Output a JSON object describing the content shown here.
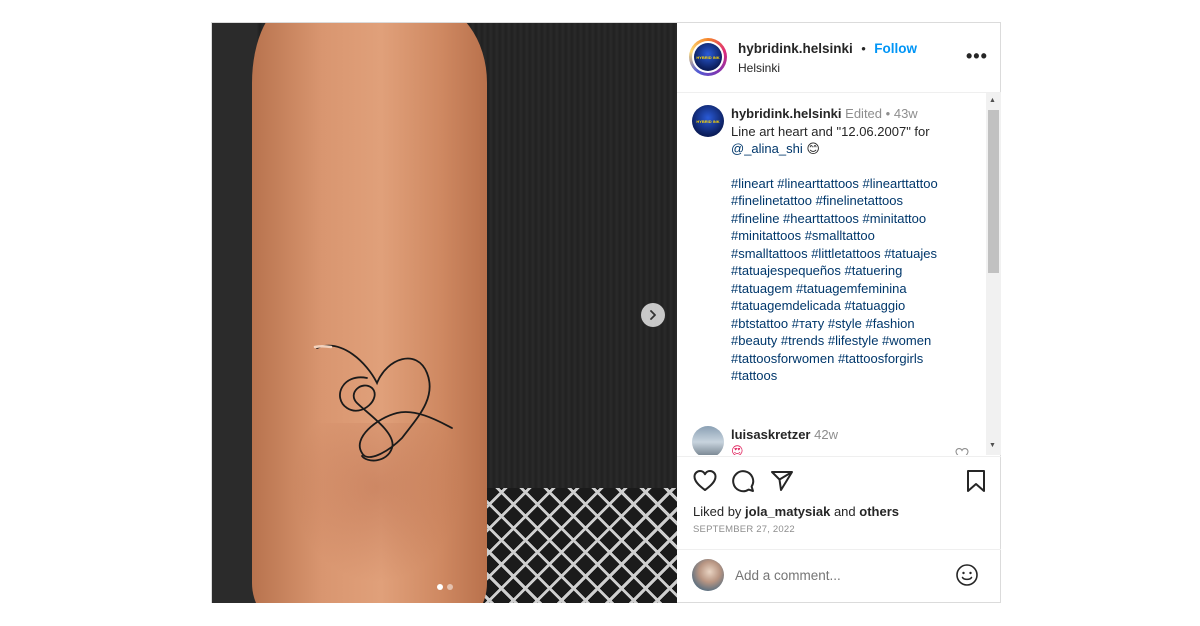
{
  "post": {
    "username": "hybridink.helsinki",
    "separator": "•",
    "follow_label": "Follow",
    "location": "Helsinki",
    "more_label": "•••",
    "avatar_text": "HYBRID INK"
  },
  "caption": {
    "username": "hybridink.helsinki",
    "edited": "Edited",
    "dot": "•",
    "time": "43w",
    "text": "Line art heart and \"12.06.2007\" for",
    "mention": "@_alina_shi",
    "emoji": "😊",
    "hashtags": [
      "#lineart #linearttattoos #linearttattoo",
      "#finelinetattoo #finelinetattoos",
      "#fineline #hearttattoos #minitattoo",
      "#minitattoos #smalltattoo",
      "#smalltattoos #littletattoos #tatuajes",
      "#tatuajespequeños #tatuering",
      "#tatuagem #tatuagemfeminina",
      "#tatuagemdelicada #tatuaggio",
      "#btstattoo #тату #style #fashion",
      "#beauty #trends #lifestyle #women",
      "#tattoosforwomen #tattoosforgirls",
      "#tattoos"
    ]
  },
  "comment2": {
    "username": "luisaskretzer",
    "time": "42w",
    "emoji": "😍"
  },
  "icons": {
    "heart": "heart-icon",
    "comment": "comment-icon",
    "share": "share-icon",
    "save": "bookmark-icon",
    "next": "chevron-right-icon",
    "emoji": "smiley-icon",
    "scroll_up": "▲",
    "scroll_down": "▼"
  },
  "likes": {
    "prefix": "Liked by ",
    "user": "jola_matysiak",
    "middle": " and ",
    "others": "others"
  },
  "date": "SEPTEMBER 27, 2022",
  "add_comment": {
    "placeholder": "Add a comment..."
  },
  "carousel": {
    "count": 2,
    "active_index": 0
  },
  "colors": {
    "accent": "#0095f6",
    "link": "#00376b",
    "muted": "#8e8e8e",
    "text": "#262626"
  }
}
